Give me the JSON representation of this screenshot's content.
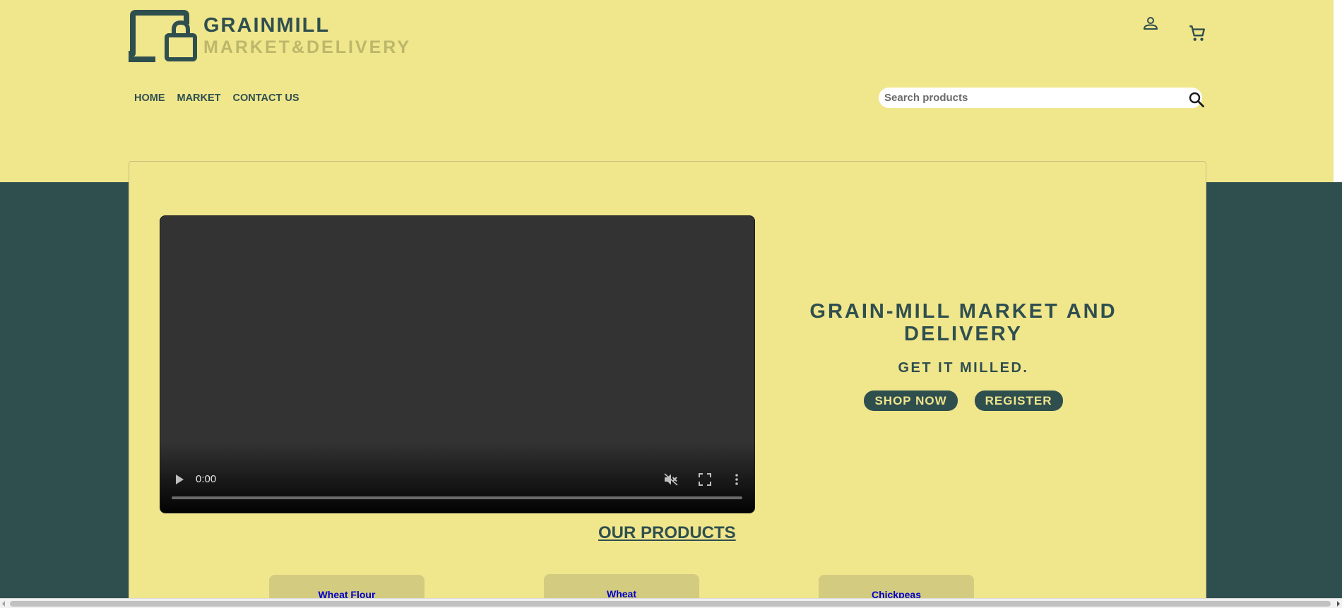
{
  "brand": {
    "title": "GRAINMILL",
    "subtitle": "MARKET&DELIVERY",
    "logo_icon": "laptop-lock-icon"
  },
  "header_icons": {
    "user": "user-icon",
    "cart": "cart-icon"
  },
  "nav": {
    "items": [
      {
        "label": "HOME"
      },
      {
        "label": "MARKET"
      },
      {
        "label": "CONTACT US"
      }
    ]
  },
  "search": {
    "placeholder": "Search products",
    "value": "",
    "icon": "search-icon"
  },
  "video": {
    "time": "0:00",
    "progress": 0,
    "controls": [
      "play-icon",
      "mute-icon",
      "fullscreen-icon",
      "more-icon"
    ]
  },
  "hero": {
    "title": "GRAIN-MILL MARKET AND DELIVERY",
    "tagline": "GET IT MILLED.",
    "shop_label": "SHOP NOW",
    "register_label": "REGISTER"
  },
  "products": {
    "title": "OUR PRODUCTS",
    "items": [
      {
        "name": "Wheat Flour"
      },
      {
        "name": "Wheat"
      },
      {
        "name": "Chickpeas"
      }
    ]
  },
  "colors": {
    "khaki": "#f0e68c",
    "dark_slate": "#2f4f4f",
    "dark_khaki": "#bdb76b",
    "card": "#d3cc80",
    "link_blue": "#0000cd"
  }
}
